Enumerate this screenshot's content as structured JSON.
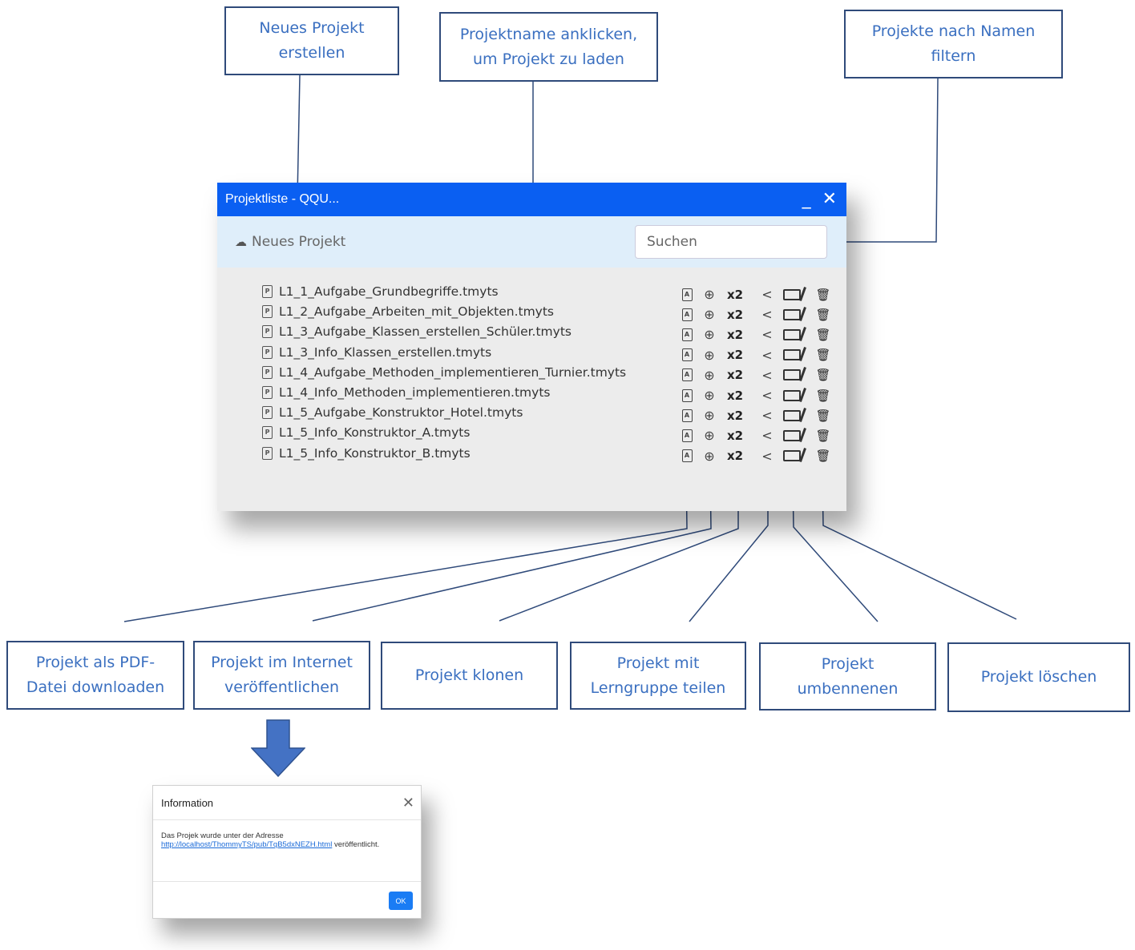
{
  "callouts": {
    "new_project": "Neues Projekt\nerstellen",
    "load_project": "Projektname anklicken,\num Projekt zu laden",
    "filter_projects": "Projekte nach Namen\nfiltern",
    "download_pdf": "Projekt als PDF-\nDatei downloaden",
    "publish_web": "Projekt im Internet\nveröffentlichen",
    "clone": "Projekt klonen",
    "share_group": "Projekt mit\nLerngruppe teilen",
    "rename": "Projekt\numbennenen",
    "delete": "Projekt löschen"
  },
  "window": {
    "title": "Projektliste - QQU...",
    "minimize_glyph": "_",
    "close_glyph": "✕",
    "new_project_label": "Neues Projekt",
    "search_placeholder": "Suchen",
    "files": [
      "L1_1_Aufgabe_Grundbegriffe.tmyts",
      "L1_2_Aufgabe_Arbeiten_mit_Objekten.tmyts",
      "L1_3_Aufgabe_Klassen_erstellen_Schüler.tmyts",
      "L1_3_Info_Klassen_erstellen.tmyts",
      "L1_4_Aufgabe_Methoden_implementieren_Turnier.tmyts",
      "L1_4_Info_Methoden_implementieren.tmyts",
      "L1_5_Aufgabe_Konstruktor_Hotel.tmyts",
      "L1_5_Info_Konstruktor_A.tmyts",
      "L1_5_Info_Konstruktor_B.tmyts"
    ],
    "clone_label": "x2"
  },
  "dialog": {
    "title": "Information",
    "text_before": "Das Projek wurde unter der Adresse",
    "link": "http://localhost/ThommyTS/pub/TqB5dxNEZH.html",
    "text_after": " veröffentlicht.",
    "ok_label": "OK"
  },
  "colors": {
    "titlebar": "#0a5ff2",
    "callout_text": "#3a6fc0",
    "callout_border": "#2f4a7a",
    "connector": "#2f4a7a",
    "arrow": "#4472c4"
  }
}
